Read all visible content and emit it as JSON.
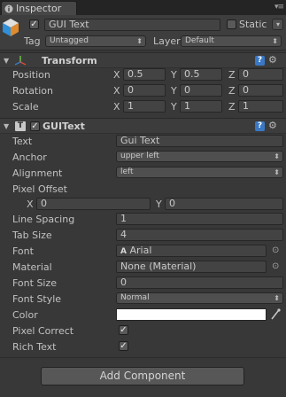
{
  "tab": {
    "title": "Inspector"
  },
  "header": {
    "object_name": "GUI Text",
    "static_label": "Static",
    "tag_label": "Tag",
    "tag_value": "Untagged",
    "layer_label": "Layer",
    "layer_value": "Default"
  },
  "transform": {
    "title": "Transform",
    "rows": [
      {
        "label": "Position",
        "x": "0.5",
        "y": "0.5",
        "z": "0"
      },
      {
        "label": "Rotation",
        "x": "0",
        "y": "0",
        "z": "0"
      },
      {
        "label": "Scale",
        "x": "1",
        "y": "1",
        "z": "1"
      }
    ],
    "axis_x": "X",
    "axis_y": "Y",
    "axis_z": "Z"
  },
  "guitext": {
    "title": "GUIText",
    "text_label": "Text",
    "text_value": "Gui Text",
    "anchor_label": "Anchor",
    "anchor_value": "upper left",
    "alignment_label": "Alignment",
    "alignment_value": "left",
    "pixel_offset_label": "Pixel Offset",
    "offset_x": "0",
    "offset_y": "0",
    "line_spacing_label": "Line Spacing",
    "line_spacing_value": "1",
    "tab_size_label": "Tab Size",
    "tab_size_value": "4",
    "font_label": "Font",
    "font_value": "Arial",
    "material_label": "Material",
    "material_value": "None (Material)",
    "font_size_label": "Font Size",
    "font_size_value": "0",
    "font_style_label": "Font Style",
    "font_style_value": "Normal",
    "color_label": "Color",
    "color_value": "#ffffff",
    "pixel_correct_label": "Pixel Correct",
    "rich_text_label": "Rich Text"
  },
  "add_component": "Add Component",
  "colors": {
    "help_icon": "#3a78c5",
    "background": "#383838"
  }
}
